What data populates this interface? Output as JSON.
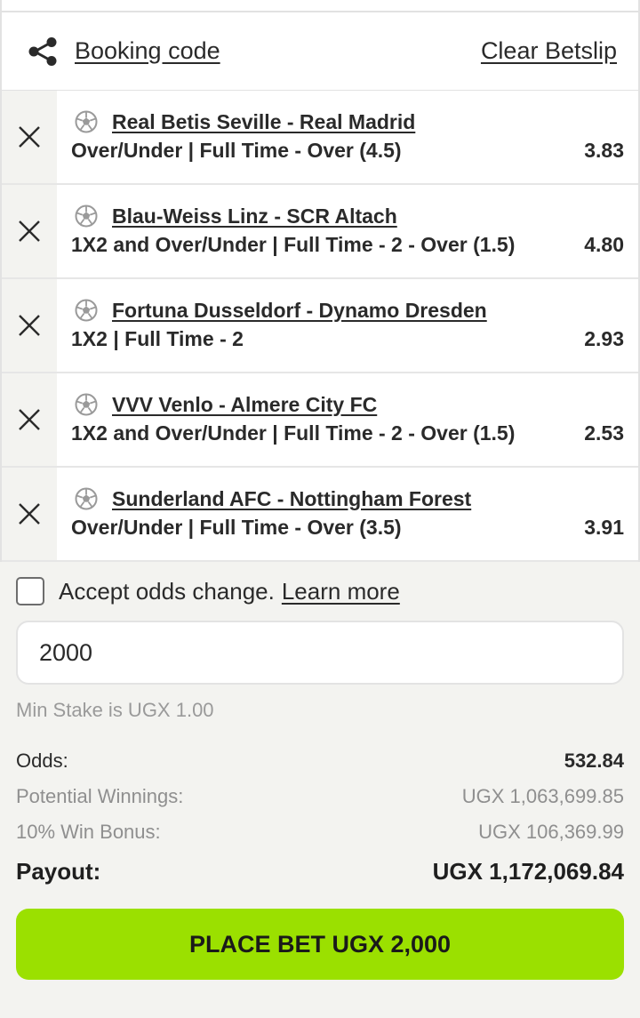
{
  "header": {
    "booking_code_label": "Booking code",
    "clear_betslip_label": "Clear Betslip",
    "share_icon": "share-icon"
  },
  "bets": [
    {
      "event": "Real Betis Seville - Real Madrid",
      "market": "Over/Under | Full Time - Over (4.5)",
      "odds": "3.83"
    },
    {
      "event": "Blau-Weiss Linz - SCR Altach",
      "market": "1X2 and Over/Under | Full Time - 2 - Over (1.5)",
      "odds": "4.80"
    },
    {
      "event": "Fortuna Dusseldorf - Dynamo Dresden",
      "market": "1X2 | Full Time - 2",
      "odds": "2.93"
    },
    {
      "event": "VVV Venlo - Almere City FC",
      "market": "1X2 and Over/Under | Full Time - 2 - Over (1.5)",
      "odds": "2.53"
    },
    {
      "event": "Sunderland AFC - Nottingham Forest",
      "market": "Over/Under | Full Time - Over (3.5)",
      "odds": "3.91"
    }
  ],
  "accept_odds": {
    "label": "Accept odds change.",
    "learn_more": "Learn more",
    "checked": false
  },
  "stake": {
    "value": "2000",
    "min_stake_text": "Min Stake is UGX 1.00"
  },
  "summary": {
    "odds_label": "Odds:",
    "odds_value": "532.84",
    "potential_label": "Potential Winnings:",
    "potential_value": "UGX 1,063,699.85",
    "bonus_label": "10% Win Bonus:",
    "bonus_value": "UGX 106,369.99",
    "payout_label": "Payout:",
    "payout_value": "UGX 1,172,069.84"
  },
  "place_bet_label": "PLACE BET UGX 2,000",
  "colors": {
    "accent_green": "#9be000",
    "background": "#f3f3f0",
    "card": "#ffffff"
  }
}
